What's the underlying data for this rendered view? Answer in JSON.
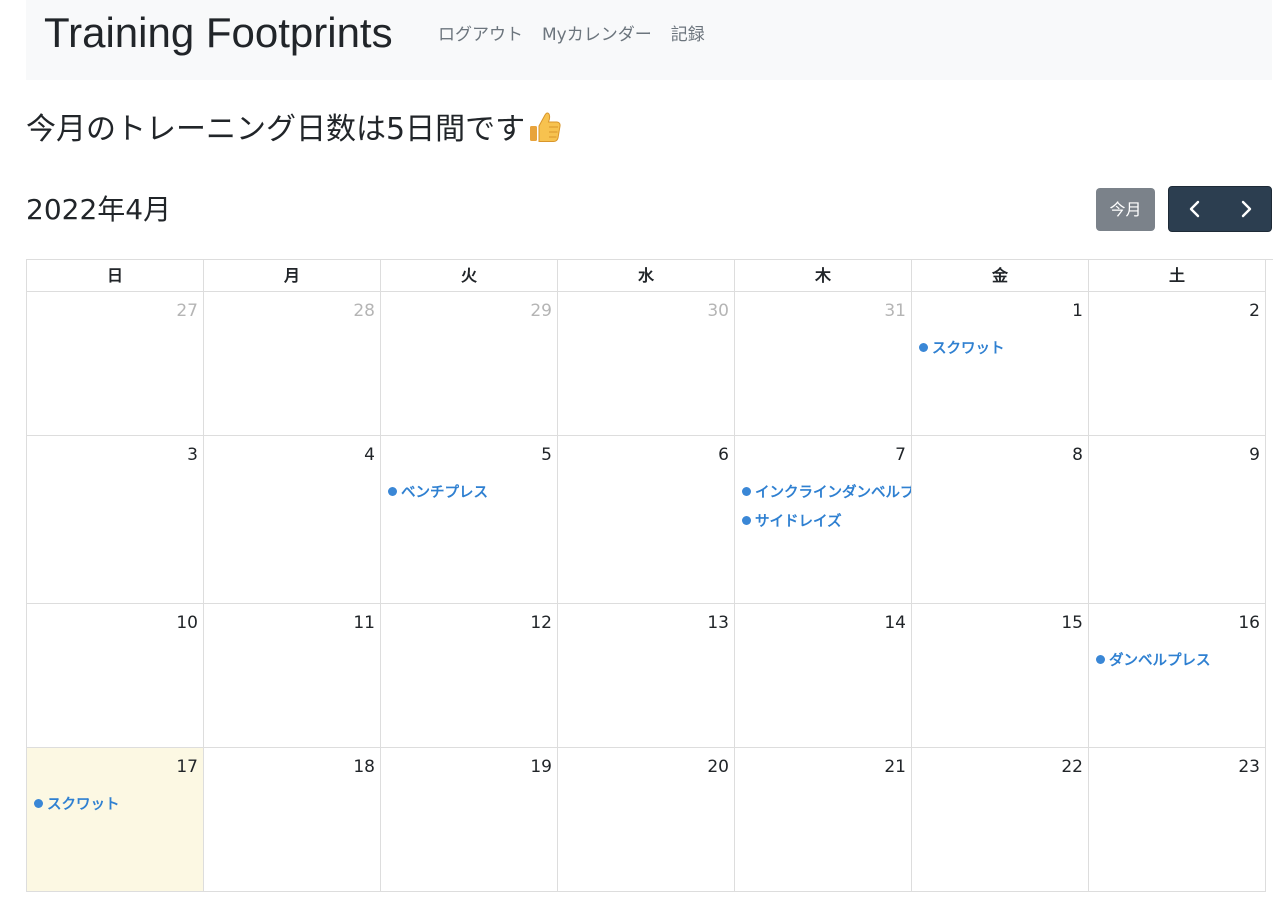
{
  "navbar": {
    "brand": "Training Footprints",
    "links": [
      "ログアウト",
      "Myカレンダー",
      "記録"
    ]
  },
  "summary": {
    "text": "今月のトレーニング日数は5日間です",
    "icon": "thumbs-up-icon"
  },
  "calendar": {
    "month_title": "2022年4月",
    "today_label": "今月",
    "prev_icon": "chevron-left-icon",
    "next_icon": "chevron-right-icon",
    "weekdays": [
      "日",
      "月",
      "火",
      "水",
      "木",
      "金",
      "土"
    ],
    "weeks": [
      [
        {
          "day": "27",
          "other": true,
          "events": []
        },
        {
          "day": "28",
          "other": true,
          "events": []
        },
        {
          "day": "29",
          "other": true,
          "events": []
        },
        {
          "day": "30",
          "other": true,
          "events": []
        },
        {
          "day": "31",
          "other": true,
          "events": []
        },
        {
          "day": "1",
          "events": [
            "スクワット"
          ]
        },
        {
          "day": "2",
          "events": []
        }
      ],
      [
        {
          "day": "3",
          "events": []
        },
        {
          "day": "4",
          "events": []
        },
        {
          "day": "5",
          "events": [
            "ベンチプレス"
          ]
        },
        {
          "day": "6",
          "events": []
        },
        {
          "day": "7",
          "events": [
            "インクラインダンベルプ",
            "サイドレイズ"
          ]
        },
        {
          "day": "8",
          "events": []
        },
        {
          "day": "9",
          "events": []
        }
      ],
      [
        {
          "day": "10",
          "events": []
        },
        {
          "day": "11",
          "events": []
        },
        {
          "day": "12",
          "events": []
        },
        {
          "day": "13",
          "events": []
        },
        {
          "day": "14",
          "events": []
        },
        {
          "day": "15",
          "events": []
        },
        {
          "day": "16",
          "events": [
            "ダンベルプレス"
          ]
        }
      ],
      [
        {
          "day": "17",
          "today": true,
          "events": [
            "スクワット"
          ]
        },
        {
          "day": "18",
          "events": []
        },
        {
          "day": "19",
          "events": []
        },
        {
          "day": "20",
          "events": []
        },
        {
          "day": "21",
          "events": []
        },
        {
          "day": "22",
          "events": []
        },
        {
          "day": "23",
          "events": []
        }
      ]
    ]
  },
  "colors": {
    "event_text": "#2f80d1",
    "event_dot": "#3a87d6",
    "today_bg": "#fcf8e3",
    "nav_button_bg": "#2c3e50",
    "today_button_bg": "#7b828a",
    "navbar_bg": "#f8f9fa"
  }
}
